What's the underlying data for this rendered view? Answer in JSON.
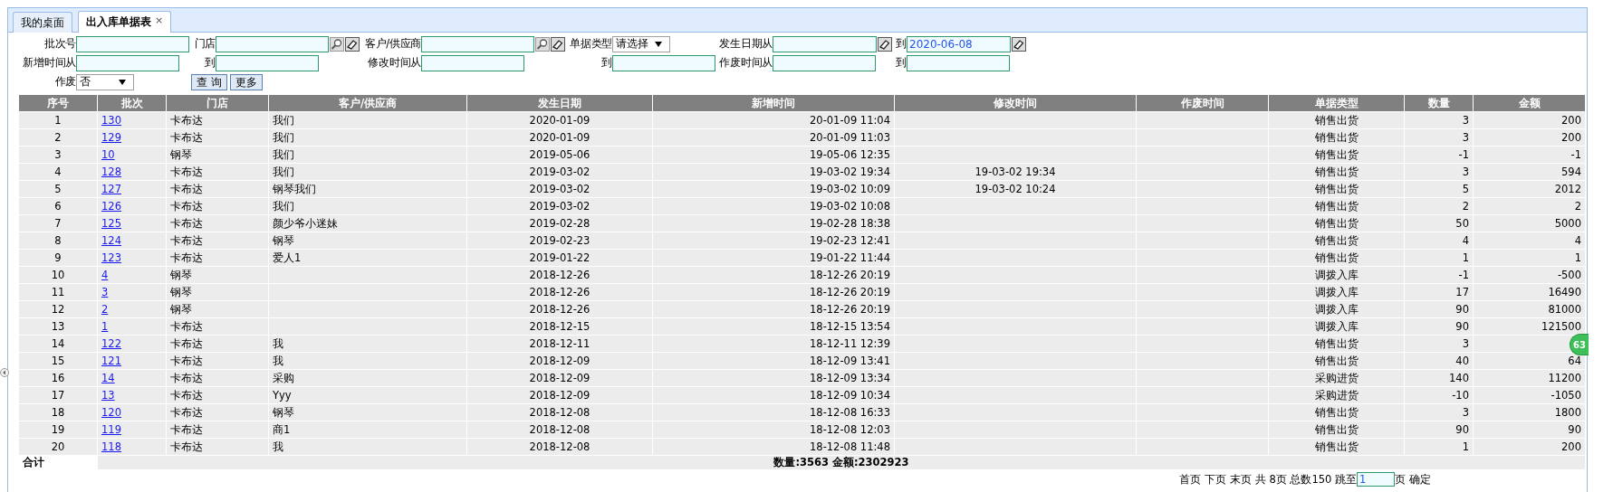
{
  "tabs": [
    {
      "label": "我的桌面",
      "selected": false,
      "closable": false
    },
    {
      "label": "出入库单据表",
      "selected": true,
      "closable": true,
      "close": "×"
    }
  ],
  "filters": [
    [
      {
        "label": "批次号",
        "kind": "text"
      },
      {
        "label": "门店",
        "kind": "text",
        "lookup": true,
        "clear": true
      },
      {
        "label": "客户/供应商",
        "kind": "text",
        "lookup": true,
        "clear": true
      },
      {
        "label": "单据类型",
        "kind": "select",
        "value": "请选择"
      },
      {
        "label": "发生日期从",
        "kind": "date",
        "clear": true
      },
      {
        "label": "到",
        "kind": "date",
        "value": "2020-06-08",
        "clear": true
      }
    ],
    [
      {
        "label": "新增时间从",
        "kind": "time"
      },
      {
        "label": "到",
        "kind": "time"
      },
      {
        "label": "修改时间从",
        "kind": "time"
      },
      {
        "label": "到",
        "kind": "time"
      },
      {
        "label": "作废时间从",
        "kind": "time"
      },
      {
        "label": "到",
        "kind": "time"
      }
    ],
    [
      {
        "label": "作废",
        "kind": "select",
        "value": "否"
      },
      {
        "kind": "buttons",
        "buttons": [
          "查 询",
          "更多"
        ]
      }
    ]
  ],
  "table": {
    "columns": [
      "序号",
      "批次",
      "门店",
      "客户/供应商",
      "发生日期",
      "新增时间",
      "修改时间",
      "作废时间",
      "单据类型",
      "数量",
      "金额"
    ],
    "rows": [
      {
        "seq": "1",
        "batch": "130",
        "store": "卡布达",
        "customer": "我们",
        "date": "2020-01-09",
        "created": "20-01-09 11:04",
        "type": "销售出货",
        "qty": "3",
        "amount": "200"
      },
      {
        "seq": "2",
        "batch": "129",
        "store": "卡布达",
        "customer": "我们",
        "date": "2020-01-09",
        "created": "20-01-09 11:03",
        "type": "销售出货",
        "qty": "3",
        "amount": "200"
      },
      {
        "seq": "3",
        "batch": "10",
        "store": "钢琴",
        "customer": "我们",
        "date": "2019-05-06",
        "created": "19-05-06 12:35",
        "type": "销售出货",
        "qty": "-1",
        "amount": "-1"
      },
      {
        "seq": "4",
        "batch": "128",
        "store": "卡布达",
        "customer": "我们",
        "date": "2019-03-02",
        "created": "19-03-02 19:34",
        "modified": "19-03-02 19:34",
        "type": "销售出货",
        "qty": "3",
        "amount": "594"
      },
      {
        "seq": "5",
        "batch": "127",
        "store": "卡布达",
        "customer": "钢琴我们",
        "date": "2019-03-02",
        "created": "19-03-02 10:09",
        "modified": "19-03-02 10:24",
        "type": "销售出货",
        "qty": "5",
        "amount": "2012"
      },
      {
        "seq": "6",
        "batch": "126",
        "store": "卡布达",
        "customer": "我们",
        "date": "2019-03-02",
        "created": "19-03-02 10:08",
        "type": "销售出货",
        "qty": "2",
        "amount": "2"
      },
      {
        "seq": "7",
        "batch": "125",
        "store": "卡布达",
        "customer": "颜少爷小迷妹",
        "date": "2019-02-28",
        "created": "19-02-28 18:38",
        "type": "销售出货",
        "qty": "50",
        "amount": "5000"
      },
      {
        "seq": "8",
        "batch": "124",
        "store": "卡布达",
        "customer": "钢琴",
        "date": "2019-02-23",
        "created": "19-02-23 12:41",
        "type": "销售出货",
        "qty": "4",
        "amount": "4"
      },
      {
        "seq": "9",
        "batch": "123",
        "store": "卡布达",
        "customer": "爱人1",
        "date": "2019-01-22",
        "created": "19-01-22 11:44",
        "type": "销售出货",
        "qty": "1",
        "amount": "1"
      },
      {
        "seq": "10",
        "batch": "4",
        "store": "钢琴",
        "date": "2018-12-26",
        "created": "18-12-26 20:19",
        "type": "调拨入库",
        "qty": "-1",
        "amount": "-500"
      },
      {
        "seq": "11",
        "batch": "3",
        "store": "钢琴",
        "date": "2018-12-26",
        "created": "18-12-26 20:19",
        "type": "调拨入库",
        "qty": "17",
        "amount": "16490"
      },
      {
        "seq": "12",
        "batch": "2",
        "store": "钢琴",
        "date": "2018-12-26",
        "created": "18-12-26 20:19",
        "type": "调拨入库",
        "qty": "90",
        "amount": "81000"
      },
      {
        "seq": "13",
        "batch": "1",
        "store": "卡布达",
        "date": "2018-12-15",
        "created": "18-12-15 13:54",
        "type": "调拨入库",
        "qty": "90",
        "amount": "121500"
      },
      {
        "seq": "14",
        "batch": "122",
        "store": "卡布达",
        "customer": "我",
        "date": "2018-12-11",
        "created": "18-12-11 12:39",
        "type": "销售出货",
        "qty": "3"
      },
      {
        "seq": "15",
        "batch": "121",
        "store": "卡布达",
        "customer": "我",
        "date": "2018-12-09",
        "created": "18-12-09 13:41",
        "type": "销售出货",
        "qty": "40",
        "amount": "64"
      },
      {
        "seq": "16",
        "batch": "14",
        "store": "卡布达",
        "customer": "采购",
        "date": "2018-12-09",
        "created": "18-12-09 13:34",
        "type": "采购进货",
        "qty": "140",
        "amount": "11200"
      },
      {
        "seq": "17",
        "batch": "13",
        "store": "卡布达",
        "customer": "Yyy",
        "date": "2018-12-09",
        "created": "18-12-09 10:34",
        "type": "采购进货",
        "qty": "-10",
        "amount": "-1050"
      },
      {
        "seq": "18",
        "batch": "120",
        "store": "卡布达",
        "customer": "钢琴",
        "date": "2018-12-08",
        "created": "18-12-08 16:33",
        "type": "销售出货",
        "qty": "3",
        "amount": "1800"
      },
      {
        "seq": "19",
        "batch": "119",
        "store": "卡布达",
        "customer": "商1",
        "date": "2018-12-08",
        "created": "18-12-08 12:03",
        "type": "销售出货",
        "qty": "90",
        "amount": "90"
      },
      {
        "seq": "20",
        "batch": "118",
        "store": "卡布达",
        "customer": "我",
        "date": "2018-12-08",
        "created": "18-12-08 11:48",
        "type": "销售出货",
        "qty": "1",
        "amount": "200"
      }
    ],
    "totals": {
      "label": "合计",
      "summary": "数量:3563 金额:2302923"
    }
  },
  "pager": {
    "links": [
      "首页",
      "下页",
      "末页"
    ],
    "info": "共 8页 总数150 跳至",
    "page_input": "1",
    "page_suffix": "页",
    "confirm": "确定"
  },
  "float_badge": {
    "text": "63"
  }
}
